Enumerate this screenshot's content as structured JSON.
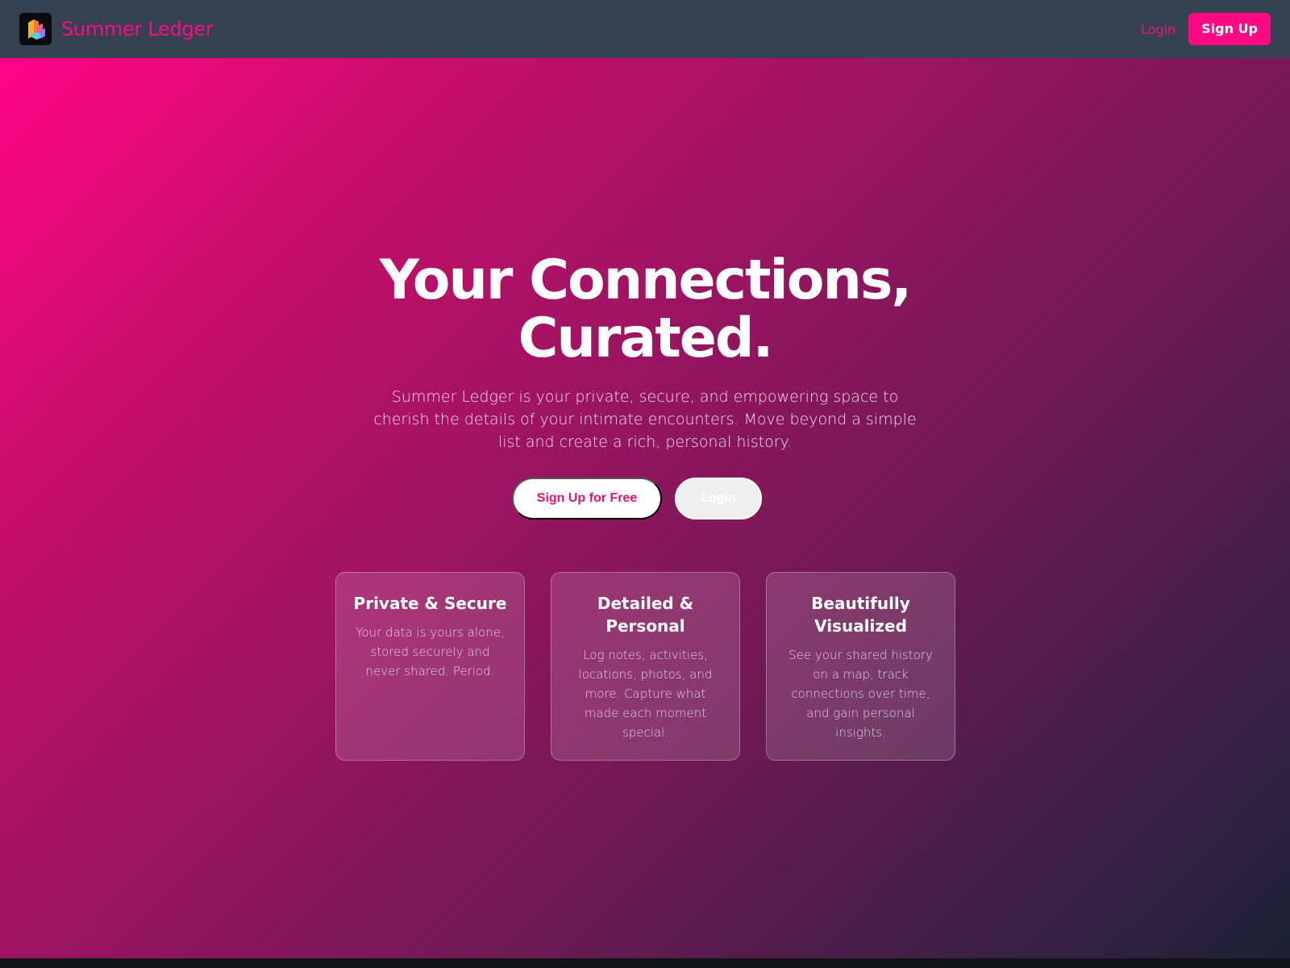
{
  "header": {
    "brand_name": "Summer Ledger",
    "logo_icon": "stacked-book-icon",
    "login_label": "Login",
    "signup_label": "Sign Up",
    "accent_color": "#ff0a84",
    "background_color": "#364152"
  },
  "hero": {
    "headline_line1": "Your Connections,",
    "headline_line2": "Curated.",
    "description": "Summer Ledger is your private, secure, and empowering space to cherish the details of your intimate encounters. Move beyond a simple list and create a rich, personal history.",
    "primary_cta_label": "Sign Up for Free",
    "secondary_cta_label": "Login",
    "gradient_start_color": "#ff0585",
    "gradient_end_color": "#1d2233"
  },
  "features": [
    {
      "title": "Private & Secure",
      "description": "Your data is yours alone, stored securely and never shared. Period."
    },
    {
      "title": "Detailed & Personal",
      "description": "Log notes, activities, locations, photos, and more. Capture what made each moment special."
    },
    {
      "title": "Beautifully Visualized",
      "description": "See your shared history on a map, track connections over time, and gain personal insights."
    }
  ]
}
